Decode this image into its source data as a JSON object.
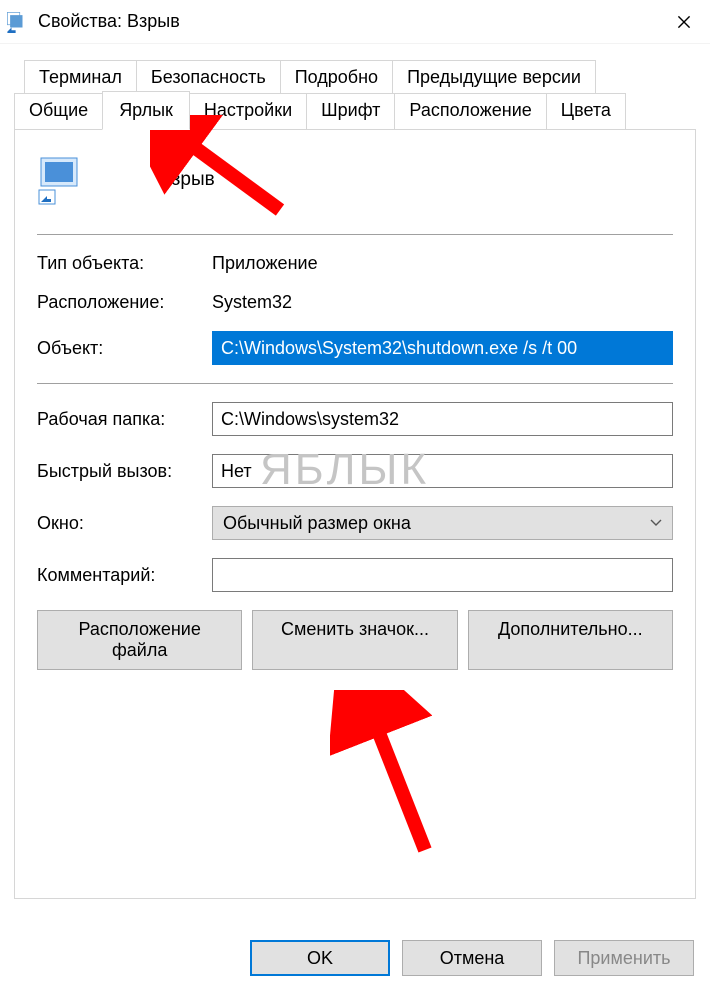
{
  "window": {
    "title": "Свойства: Взрыв"
  },
  "tabs": {
    "row1": [
      "Терминал",
      "Безопасность",
      "Подробно",
      "Предыдущие версии"
    ],
    "row2": [
      "Общие",
      "Ярлык",
      "Настройки",
      "Шрифт",
      "Расположение",
      "Цвета"
    ],
    "active": "Ярлык"
  },
  "shortcut": {
    "name": "Взрыв",
    "fields": {
      "type_label": "Тип объекта:",
      "type_value": "Приложение",
      "location_label": "Расположение:",
      "location_value": "System32",
      "target_label": "Объект:",
      "target_value": "C:\\Windows\\System32\\shutdown.exe /s /t 00",
      "workdir_label": "Рабочая папка:",
      "workdir_value": "C:\\Windows\\system32",
      "hotkey_label": "Быстрый вызов:",
      "hotkey_value": "Нет",
      "run_label": "Окно:",
      "run_value": "Обычный размер окна",
      "comment_label": "Комментарий:",
      "comment_value": ""
    },
    "buttons": {
      "open_location": "Расположение файла",
      "change_icon": "Сменить значок...",
      "advanced": "Дополнительно..."
    }
  },
  "footer": {
    "ok": "OK",
    "cancel": "Отмена",
    "apply": "Применить"
  },
  "watermark": "ЯБЛЫК"
}
